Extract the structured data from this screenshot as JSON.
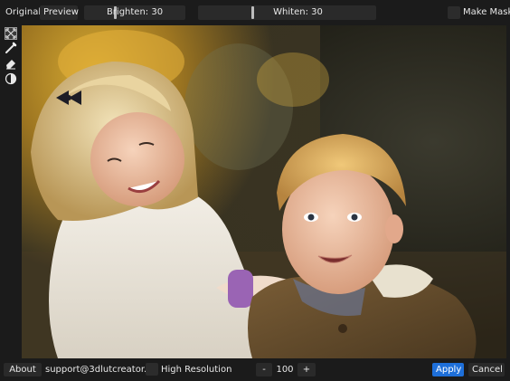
{
  "toolbar": {
    "original_label": "Original",
    "preview_label": "Preview",
    "brighten_label": "Brighten: 30",
    "whiten_label": "Whiten: 30",
    "make_mask_label": "Make Mask",
    "brighten_level": 0.3,
    "whiten_level": 0.3
  },
  "tools": [
    {
      "icon": "fit-screen-icon"
    },
    {
      "icon": "brush-icon"
    },
    {
      "icon": "eraser-icon"
    },
    {
      "icon": "contrast-icon"
    }
  ],
  "bottom": {
    "about_label": "About",
    "support_email": "support@3dlutcreator.ru",
    "high_res_label": "High Resolution",
    "minus_label": "-",
    "zoom_value": "100",
    "plus_label": "+",
    "apply_label": "Apply",
    "cancel_label": "Cancel"
  },
  "colors": {
    "accent": "#1e6fd9",
    "background": "#1b1b1b",
    "control": "#2a2a2a"
  }
}
